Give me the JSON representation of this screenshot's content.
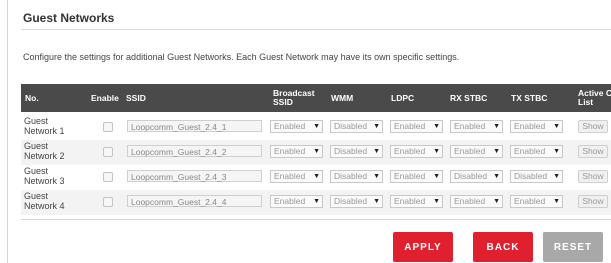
{
  "page": {
    "title": "Guest Networks",
    "description": "Configure the settings for additional Guest Networks. Each Guest Network may have its own specific settings."
  },
  "table": {
    "headers": {
      "no": "No.",
      "enable": "Enable",
      "ssid": "SSID",
      "broadcast_1": "Broadcast",
      "broadcast_2": "SSID",
      "wmm": "WMM",
      "ldpc": "LDPC",
      "rx_stbc": "RX STBC",
      "tx_stbc": "TX STBC",
      "active_1": "Active Client",
      "active_2": "List"
    },
    "rows": [
      {
        "name_1": "Guest",
        "name_2": "Network 1",
        "ssid": "Loopcomm_Guest_2.4_1",
        "broadcast": "Enabled",
        "wmm": "Disabled",
        "ldpc": "Enabled",
        "rx_stbc": "Enabled",
        "tx_stbc": "Enabled",
        "show": "Show"
      },
      {
        "name_1": "Guest",
        "name_2": "Network 2",
        "ssid": "Loopcomm_Guest_2.4_2",
        "broadcast": "Enabled",
        "wmm": "Disabled",
        "ldpc": "Enabled",
        "rx_stbc": "Enabled",
        "tx_stbc": "Enabled",
        "show": "Show"
      },
      {
        "name_1": "Guest",
        "name_2": "Network 3",
        "ssid": "Loopcomm_Guest_2.4_3",
        "broadcast": "Enabled",
        "wmm": "Disabled",
        "ldpc": "Enabled",
        "rx_stbc": "Disabled",
        "tx_stbc": "Disabled",
        "show": "Show"
      },
      {
        "name_1": "Guest",
        "name_2": "Network 4",
        "ssid": "Loopcomm_Guest_2.4_4",
        "broadcast": "Enabled",
        "wmm": "Disabled",
        "ldpc": "Enabled",
        "rx_stbc": "Enabled",
        "tx_stbc": "Enabled",
        "show": "Show"
      }
    ]
  },
  "actions": {
    "apply": "APPLY",
    "back": "BACK",
    "reset": "RESET"
  },
  "colors": {
    "header_bg": "#4a4a4a",
    "primary_button": "#e0202e",
    "secondary_button": "#a8a8a8"
  }
}
